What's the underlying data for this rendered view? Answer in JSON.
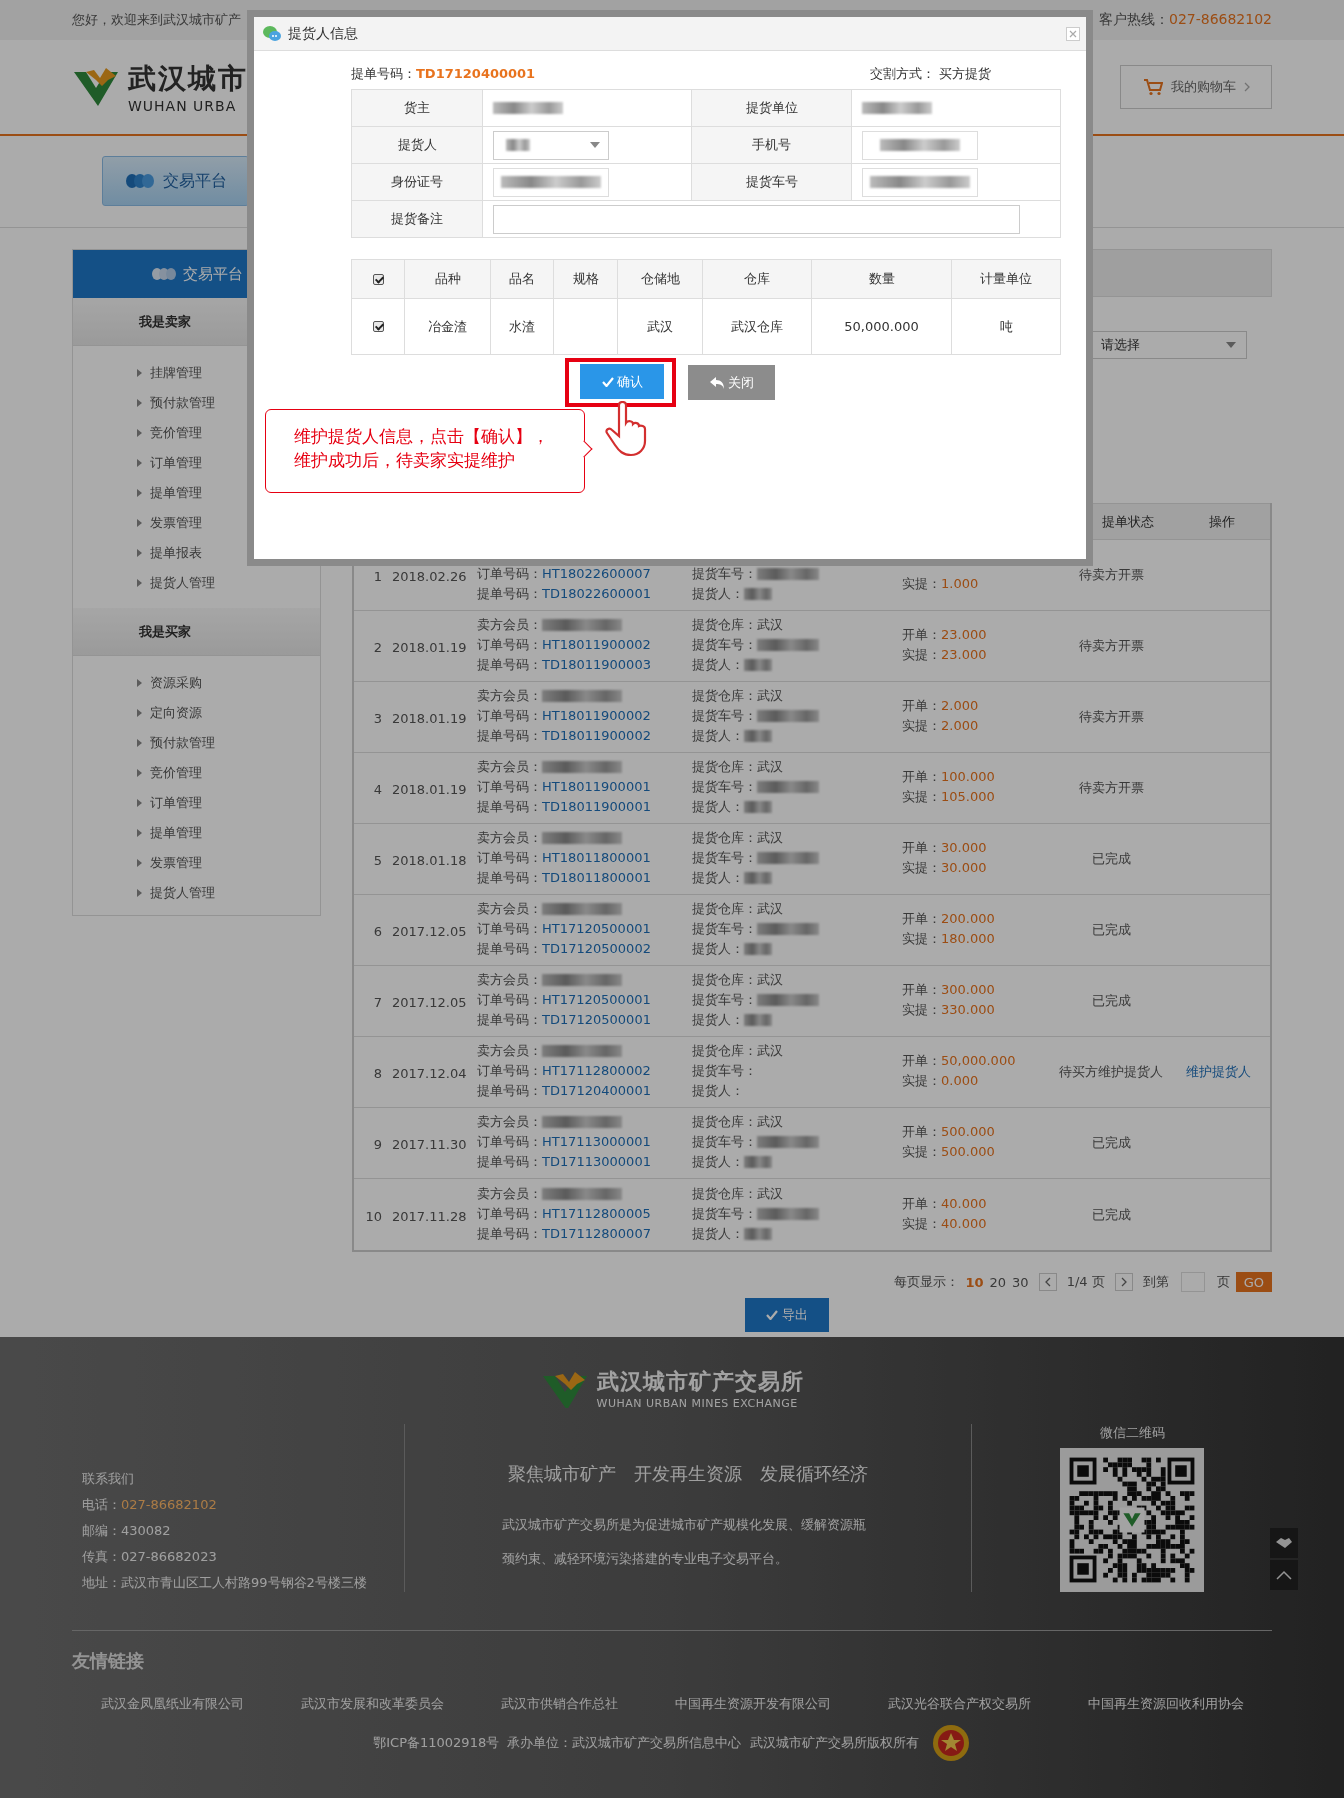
{
  "top_bar": {
    "greeting": "您好，欢迎来到武汉城市矿产",
    "hotline_label": "客户热线：",
    "hotline": "027-86682102"
  },
  "header": {
    "logo_cn": "武汉城市",
    "logo_en": "WUHAN URBA",
    "cart": "我的购物车"
  },
  "nav_tabs": [
    {
      "label": "交易平台",
      "selected": true
    }
  ],
  "sidebar": {
    "title": "交易平台",
    "sections": [
      {
        "title": "我是卖家",
        "items": [
          "挂牌管理",
          "预付款管理",
          "竞价管理",
          "订单管理",
          "提单管理",
          "发票管理",
          "提单报表",
          "提货人管理"
        ]
      },
      {
        "title": "我是买家",
        "items": [
          "资源采购",
          "定向资源",
          "预付款管理",
          "竞价管理",
          "订单管理",
          "提单管理",
          "发票管理",
          "提货人管理"
        ]
      }
    ]
  },
  "filter": {
    "select_placeholder": "请选择"
  },
  "table": {
    "status_header": "提单状态",
    "action_header": "操作",
    "rows": [
      {
        "index": "1",
        "date": "2018.02.26",
        "left": [
          {
            "label": "订单号码：",
            "value": "HT18022600007"
          },
          {
            "label": "提单号码：",
            "value": "TD18022600001"
          }
        ],
        "middle": [
          {
            "label": "提货车号：",
            "redacted": true
          },
          {
            "label": "提货人：",
            "redacted": true
          }
        ],
        "qty": [
          {
            "label": "实提：",
            "value": "1.000"
          }
        ],
        "status": "待卖方开票"
      },
      {
        "index": "2",
        "date": "2018.01.19",
        "left": [
          {
            "label": "卖方会员：",
            "redacted": true
          },
          {
            "label": "订单号码：",
            "value": "HT18011900002"
          },
          {
            "label": "提单号码：",
            "value": "TD18011900003"
          }
        ],
        "middle": [
          {
            "label": "提货仓库：",
            "value": "武汉"
          },
          {
            "label": "提货车号：",
            "redacted": true
          },
          {
            "label": "提货人：",
            "redacted": true
          }
        ],
        "qty": [
          {
            "label": "开单：",
            "value": "23.000"
          },
          {
            "label": "实提：",
            "value": "23.000"
          }
        ],
        "status": "待卖方开票"
      },
      {
        "index": "3",
        "date": "2018.01.19",
        "left": [
          {
            "label": "卖方会员：",
            "redacted": true
          },
          {
            "label": "订单号码：",
            "value": "HT18011900002"
          },
          {
            "label": "提单号码：",
            "value": "TD18011900002"
          }
        ],
        "middle": [
          {
            "label": "提货仓库：",
            "value": "武汉"
          },
          {
            "label": "提货车号：",
            "redacted": true
          },
          {
            "label": "提货人：",
            "redacted": true
          }
        ],
        "qty": [
          {
            "label": "开单：",
            "value": "2.000"
          },
          {
            "label": "实提：",
            "value": "2.000"
          }
        ],
        "status": "待卖方开票"
      },
      {
        "index": "4",
        "date": "2018.01.19",
        "left": [
          {
            "label": "卖方会员：",
            "redacted": true
          },
          {
            "label": "订单号码：",
            "value": "HT18011900001"
          },
          {
            "label": "提单号码：",
            "value": "TD18011900001"
          }
        ],
        "middle": [
          {
            "label": "提货仓库：",
            "value": "武汉"
          },
          {
            "label": "提货车号：",
            "redacted": true
          },
          {
            "label": "提货人：",
            "redacted": true
          }
        ],
        "qty": [
          {
            "label": "开单：",
            "value": "100.000"
          },
          {
            "label": "实提：",
            "value": "105.000"
          }
        ],
        "status": "待卖方开票"
      },
      {
        "index": "5",
        "date": "2018.01.18",
        "left": [
          {
            "label": "卖方会员：",
            "redacted": true
          },
          {
            "label": "订单号码：",
            "value": "HT18011800001"
          },
          {
            "label": "提单号码：",
            "value": "TD18011800001"
          }
        ],
        "middle": [
          {
            "label": "提货仓库：",
            "value": "武汉"
          },
          {
            "label": "提货车号：",
            "redacted": true
          },
          {
            "label": "提货人：",
            "redacted": true
          }
        ],
        "qty": [
          {
            "label": "开单：",
            "value": "30.000"
          },
          {
            "label": "实提：",
            "value": "30.000"
          }
        ],
        "status": "已完成"
      },
      {
        "index": "6",
        "date": "2017.12.05",
        "left": [
          {
            "label": "卖方会员：",
            "redacted": true
          },
          {
            "label": "订单号码：",
            "value": "HT17120500001"
          },
          {
            "label": "提单号码：",
            "value": "TD17120500002"
          }
        ],
        "middle": [
          {
            "label": "提货仓库：",
            "value": "武汉"
          },
          {
            "label": "提货车号：",
            "redacted": true
          },
          {
            "label": "提货人：",
            "redacted": true
          }
        ],
        "qty": [
          {
            "label": "开单：",
            "value": "200.000"
          },
          {
            "label": "实提：",
            "value": "180.000"
          }
        ],
        "status": "已完成"
      },
      {
        "index": "7",
        "date": "2017.12.05",
        "left": [
          {
            "label": "卖方会员：",
            "redacted": true
          },
          {
            "label": "订单号码：",
            "value": "HT17120500001"
          },
          {
            "label": "提单号码：",
            "value": "TD17120500001"
          }
        ],
        "middle": [
          {
            "label": "提货仓库：",
            "value": "武汉"
          },
          {
            "label": "提货车号：",
            "redacted": true
          },
          {
            "label": "提货人：",
            "redacted": true
          }
        ],
        "qty": [
          {
            "label": "开单：",
            "value": "300.000"
          },
          {
            "label": "实提：",
            "value": "330.000"
          }
        ],
        "status": "已完成"
      },
      {
        "index": "8",
        "date": "2017.12.04",
        "left": [
          {
            "label": "卖方会员：",
            "redacted": true
          },
          {
            "label": "订单号码：",
            "value": "HT17112800002"
          },
          {
            "label": "提单号码：",
            "value": "TD17120400001"
          }
        ],
        "middle": [
          {
            "label": "提货仓库：",
            "value": "武汉"
          },
          {
            "label": "提货车号：",
            "redacted": false
          },
          {
            "label": "提货人：",
            "redacted": false
          }
        ],
        "qty": [
          {
            "label": "开单：",
            "value": "50,000.000"
          },
          {
            "label": "实提：",
            "value": "0.000"
          }
        ],
        "status": "待买方维护提货人",
        "action": "维护提货人"
      },
      {
        "index": "9",
        "date": "2017.11.30",
        "left": [
          {
            "label": "卖方会员：",
            "redacted": true
          },
          {
            "label": "订单号码：",
            "value": "HT17113000001"
          },
          {
            "label": "提单号码：",
            "value": "TD17113000001"
          }
        ],
        "middle": [
          {
            "label": "提货仓库：",
            "value": "武汉"
          },
          {
            "label": "提货车号：",
            "redacted": true
          },
          {
            "label": "提货人：",
            "redacted": true
          }
        ],
        "qty": [
          {
            "label": "开单：",
            "value": "500.000"
          },
          {
            "label": "实提：",
            "value": "500.000"
          }
        ],
        "status": "已完成"
      },
      {
        "index": "10",
        "date": "2017.11.28",
        "left": [
          {
            "label": "卖方会员：",
            "redacted": true
          },
          {
            "label": "订单号码：",
            "value": "HT17112800005"
          },
          {
            "label": "提单号码：",
            "value": "TD17112800007"
          }
        ],
        "middle": [
          {
            "label": "提货仓库：",
            "value": "武汉"
          },
          {
            "label": "提货车号：",
            "redacted": true
          },
          {
            "label": "提货人：",
            "redacted": true
          }
        ],
        "qty": [
          {
            "label": "开单：",
            "value": "40.000"
          },
          {
            "label": "实提：",
            "value": "40.000"
          }
        ],
        "status": "已完成"
      }
    ]
  },
  "pagination": {
    "per_page_label": "每页显示：",
    "sizes": [
      {
        "label": "10",
        "selected": true
      },
      {
        "label": "20",
        "selected": false
      },
      {
        "label": "30",
        "selected": false
      }
    ],
    "page_info": "1/4 页",
    "goto_label": "到第",
    "page_suffix": "页",
    "go": "GO"
  },
  "export_button": "导出",
  "modal": {
    "title": "提货人信息",
    "bill_label": "提单号码：",
    "bill_no": "TD17120400001",
    "delivery_label": "交割方式：",
    "delivery": "买方提货",
    "form": [
      [
        {
          "label": "货主",
          "kind": "text"
        },
        {
          "label": "提货单位",
          "kind": "text"
        }
      ],
      [
        {
          "label": "提货人",
          "kind": "select"
        },
        {
          "label": "手机号",
          "kind": "input"
        }
      ],
      [
        {
          "label": "身份证号",
          "kind": "input"
        },
        {
          "label": "提货车号",
          "kind": "input"
        }
      ],
      [
        {
          "label": "提货备注",
          "kind": "wide"
        }
      ]
    ],
    "goods": {
      "all_checked": true,
      "columns": [
        "品种",
        "品名",
        "规格",
        "仓储地",
        "仓库",
        "数量",
        "计量单位"
      ],
      "rows": [
        {
          "checked": true,
          "cells": [
            "冶金渣",
            "水渣",
            "",
            "武汉",
            "武汉仓库",
            "50,000.000",
            "吨"
          ]
        }
      ]
    },
    "confirm": "确认",
    "close": "关闭",
    "callout": "维护提货人信息，点击【确认】，维护成功后，待卖家实提维护"
  },
  "footer": {
    "logo_cn": "武汉城市矿产交易所",
    "logo_en": "WUHAN URBAN MINES EXCHANGE",
    "contact_title": "联系我们",
    "phone_label": "电话：",
    "phone": "027-86682102",
    "postcode": "邮编：430082",
    "fax": "传真：027-86682023",
    "address": "地址：武汉市青山区工人村路99号钢谷2号楼三楼",
    "slogans": [
      "聚焦城市矿产",
      "开发再生资源",
      "发展循环经济"
    ],
    "description": "武汉城市矿产交易所是为促进城市矿产规模化发展、缓解资源瓶颈约束、减轻环境污染搭建的专业电子交易平台。",
    "qr_label": "微信二维码",
    "links_title": "友情链接",
    "links": [
      "武汉金凤凰纸业有限公司",
      "武汉市发展和改革委员会",
      "武汉市供销合作总社",
      "中国再生资源开发有限公司",
      "武汉光谷联合产权交易所",
      "中国再生资源回收利用协会"
    ],
    "copyright": "鄂ICP备11002918号  承办单位：武汉城市矿产交易所信息中心  武汉城市矿产交易所版权所有"
  }
}
